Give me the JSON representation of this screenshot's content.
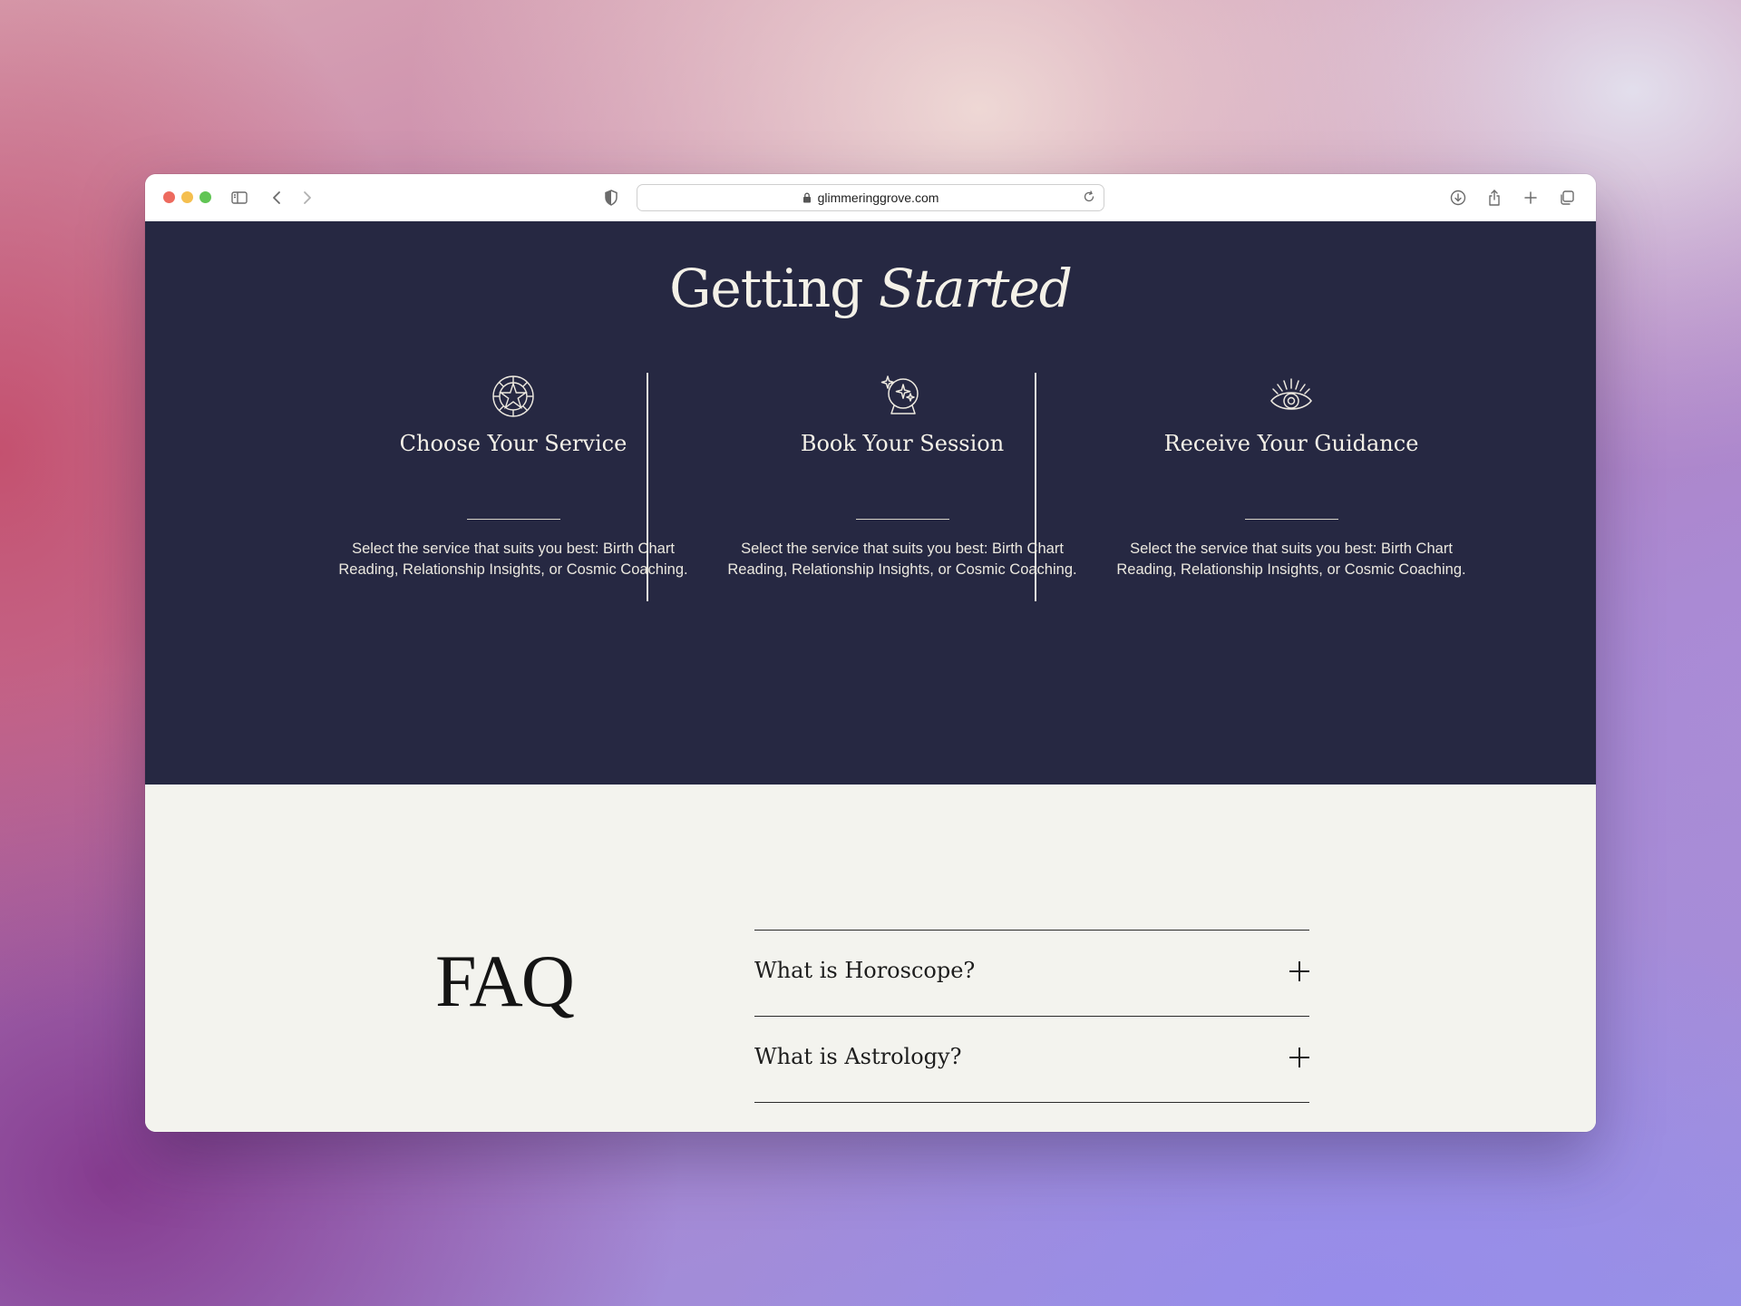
{
  "browser": {
    "url": "glimmeringgrove.com"
  },
  "getting_started": {
    "title_regular": "Getting ",
    "title_italic": "Started",
    "steps": [
      {
        "icon": "zodiac-wheel-icon",
        "title": "Choose Your Service",
        "description": "Select the service that suits you best: Birth Chart Reading, Relationship Insights, or Cosmic Coaching."
      },
      {
        "icon": "crystal-ball-icon",
        "title": "Book Your Session",
        "description": "Select the service that suits you best: Birth Chart Reading, Relationship Insights, or Cosmic Coaching."
      },
      {
        "icon": "all-seeing-eye-icon",
        "title": "Receive Your Guidance",
        "description": "Select the service that suits you best: Birth Chart Reading, Relationship Insights, or Cosmic Coaching."
      }
    ]
  },
  "faq": {
    "title": "FAQ",
    "items": [
      {
        "question": "What is Horoscope?"
      },
      {
        "question": "What is Astrology?"
      }
    ]
  },
  "colors": {
    "dark_section_bg": "#262842",
    "light_section_bg": "#f3f3ee",
    "cream_text": "#f4f1e8"
  }
}
